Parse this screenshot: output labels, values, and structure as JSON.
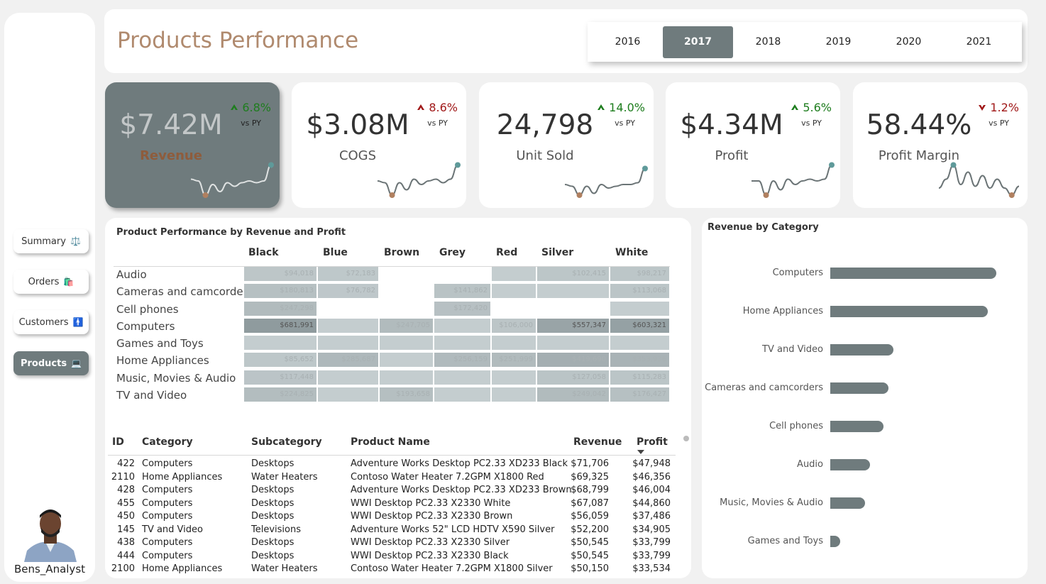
{
  "header": {
    "title": "Products Performance",
    "years": [
      "2016",
      "2017",
      "2018",
      "2019",
      "2020",
      "2021"
    ],
    "selected_year": "2017"
  },
  "nav": [
    {
      "label": "Summary",
      "emoji": "⚖️"
    },
    {
      "label": "Orders",
      "emoji": "🛍️"
    },
    {
      "label": "Customers",
      "emoji": "🚹"
    },
    {
      "label": "Products",
      "emoji": "💻"
    }
  ],
  "profile": {
    "name": "Bens_Analyst"
  },
  "kpis": [
    {
      "value": "$7.42M",
      "label": "Revenue",
      "change": "6.8%",
      "direction": "up",
      "vs": "vs PY",
      "trend": [
        0.55,
        0.5,
        0.1,
        0.4,
        0.2,
        0.45,
        0.35,
        0.45,
        0.5,
        0.45,
        0.5,
        0.95
      ]
    },
    {
      "value": "$3.08M",
      "label": "COGS",
      "change": "8.6%",
      "direction": "up",
      "vs": "vs PY",
      "trend": [
        0.5,
        0.45,
        0.1,
        0.45,
        0.25,
        0.55,
        0.4,
        0.5,
        0.55,
        0.45,
        0.55,
        0.95
      ]
    },
    {
      "value": "24,798",
      "label": "Unit Sold",
      "change": "14.0%",
      "direction": "up",
      "vs": "vs PY",
      "trend": [
        0.4,
        0.35,
        0.1,
        0.35,
        0.15,
        0.4,
        0.3,
        0.35,
        0.4,
        0.4,
        0.45,
        0.85
      ]
    },
    {
      "value": "$4.34M",
      "label": "Profit",
      "change": "5.6%",
      "direction": "up",
      "vs": "vs PY",
      "trend": [
        0.5,
        0.5,
        0.1,
        0.5,
        0.25,
        0.55,
        0.4,
        0.5,
        0.55,
        0.5,
        0.55,
        0.95
      ]
    },
    {
      "value": "58.44%",
      "label": "Profit Margin",
      "change": "1.2%",
      "direction": "down",
      "vs": "vs PY",
      "trend": [
        0.3,
        0.55,
        0.95,
        0.4,
        0.75,
        0.35,
        0.65,
        0.3,
        0.55,
        0.3,
        0.1,
        0.35
      ]
    }
  ],
  "matrix": {
    "title": "Product Performance by Revenue and Profit",
    "columns": [
      "Black",
      "Blue",
      "Brown",
      "Grey",
      "Red",
      "Silver",
      "White"
    ],
    "rows": [
      "Audio",
      "Cameras and camcorders",
      "Cell phones",
      "Computers",
      "Games and Toys",
      "Home Appliances",
      "Music, Movies & Audio",
      "TV and Video"
    ],
    "cells": [
      [
        "$94,018",
        "$72,183",
        "",
        "",
        "",
        "$102,415",
        "$98,217"
      ],
      [
        "$180,813",
        "$76,782",
        "",
        "$141,862",
        "",
        "",
        "$113,068"
      ],
      [
        "$247,298",
        "",
        "",
        "$172,420",
        "",
        "",
        ""
      ],
      [
        "$681,991",
        "",
        "$247,705",
        "",
        "$106,000",
        "$557,347",
        "$603,321"
      ],
      [
        "",
        "",
        "",
        "",
        "",
        "",
        ""
      ],
      [
        "$85,652",
        "$285,687",
        "",
        "$256,159",
        "$251,999",
        "$419,690",
        "$353,936"
      ],
      [
        "$117,448",
        "",
        "",
        "",
        "",
        "$127,058",
        "$115,283"
      ],
      [
        "$224,825",
        "",
        "$193,658",
        "",
        "",
        "$249,042",
        "$176,427"
      ]
    ]
  },
  "table": {
    "headers": [
      "ID",
      "Category",
      "Subcategory",
      "Product Name",
      "Revenue",
      "Profit"
    ],
    "rows": [
      [
        "422",
        "Computers",
        "Desktops",
        "Adventure Works Desktop PC2.33 XD233 Black",
        "$71,706",
        "$47,948"
      ],
      [
        "2110",
        "Home Appliances",
        "Water Heaters",
        "Contoso Water Heater 7.2GPM X1800 Red",
        "$69,325",
        "$46,356"
      ],
      [
        "428",
        "Computers",
        "Desktops",
        "Adventure Works Desktop PC2.33 XD233 Brown",
        "$68,799",
        "$46,004"
      ],
      [
        "455",
        "Computers",
        "Desktops",
        "WWI Desktop PC2.33 X2330 White",
        "$67,087",
        "$44,860"
      ],
      [
        "450",
        "Computers",
        "Desktops",
        "WWI Desktop PC2.33 X2330 Brown",
        "$56,059",
        "$37,486"
      ],
      [
        "145",
        "TV and Video",
        "Televisions",
        "Adventure Works 52\" LCD HDTV X590 Silver",
        "$52,200",
        "$34,905"
      ],
      [
        "438",
        "Computers",
        "Desktops",
        "WWI Desktop PC2.33 X2330 Silver",
        "$50,545",
        "$33,799"
      ],
      [
        "444",
        "Computers",
        "Desktops",
        "WWI Desktop PC2.33 X2330 Black",
        "$50,545",
        "$33,799"
      ],
      [
        "2100",
        "Home Appliances",
        "Water Heaters",
        "Contoso Water Heater 7.2GPM X1800 Silver",
        "$50,150",
        "$33,534"
      ]
    ]
  },
  "chart_data": {
    "type": "bar",
    "title": "Revenue by Category",
    "categories": [
      "Computers",
      "Home Appliances",
      "TV and Video",
      "Cameras and camcorders",
      "Cell phones",
      "Audio",
      "Music, Movies & Audio",
      "Games and Toys"
    ],
    "values": [
      100,
      95,
      38,
      35,
      32,
      24,
      21,
      6
    ],
    "color": "#6f7b7d"
  },
  "colors": {
    "accent": "#6f7b7d",
    "title": "#b08a6e",
    "up": "#1e7d1e",
    "down": "#a01818",
    "spark_line": "#6b7476",
    "spark_end": "#5f9a9a",
    "spark_min": "#b08060"
  }
}
